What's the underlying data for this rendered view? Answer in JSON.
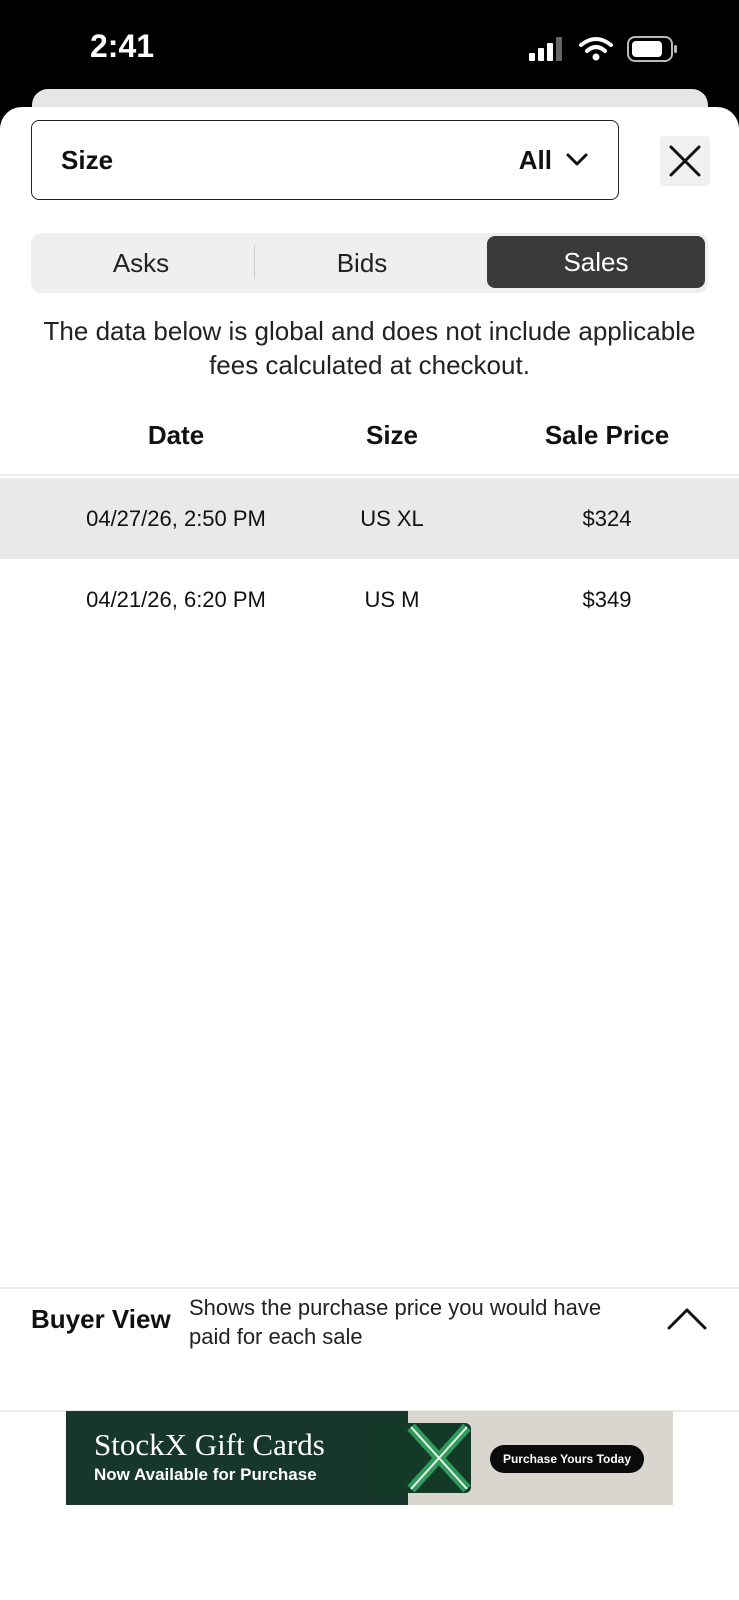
{
  "status_bar": {
    "time": "2:41"
  },
  "filter": {
    "label": "Size",
    "value": "All"
  },
  "tabs": [
    {
      "label": "Asks",
      "active": false
    },
    {
      "label": "Bids",
      "active": false
    },
    {
      "label": "Sales",
      "active": true
    }
  ],
  "disclaimer": "The data below is global and does not include applicable fees calculated at checkout.",
  "table": {
    "headers": [
      "Date",
      "Size",
      "Sale Price"
    ],
    "rows": [
      {
        "date": "04/27/26, 2:50 PM",
        "size": "US XL",
        "price": "$324",
        "highlighted": true
      },
      {
        "date": "04/21/26, 6:20 PM",
        "size": "US M",
        "price": "$349",
        "highlighted": false
      }
    ]
  },
  "buyer_view": {
    "title": "Buyer View",
    "description": "Shows the purchase price you would have paid for each sale"
  },
  "banner": {
    "title": "StockX Gift Cards",
    "subtitle": "Now Available for Purchase",
    "cta": "Purchase Yours Today",
    "card_text": "StockX",
    "colors": {
      "left": "#17372a",
      "right": "#d8d6cf",
      "accent": "#2f9a5a"
    }
  },
  "colors": {
    "active_tab": "#3a3a3a",
    "highlight_row": "#e9e9e9"
  },
  "icons": [
    "signal-icon",
    "wifi-icon",
    "battery-icon",
    "chevron-down-icon",
    "close-icon",
    "chevron-up-icon"
  ]
}
